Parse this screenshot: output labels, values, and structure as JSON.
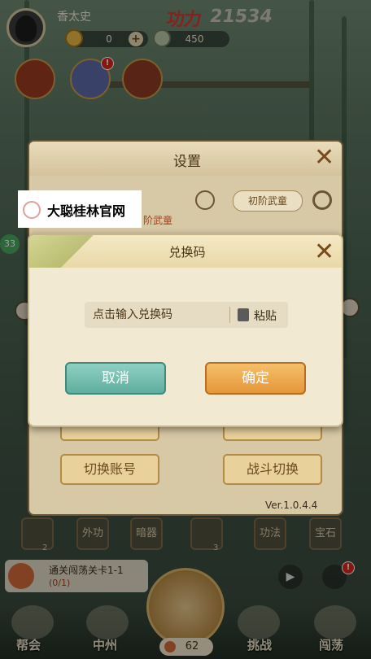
{
  "player": {
    "name": "香太史",
    "power_label": "功力",
    "power_value": "21534"
  },
  "resources": {
    "gold": "0",
    "jade": "450"
  },
  "features": [
    {
      "icon": "lantern-icon"
    },
    {
      "icon": "mascot-icon",
      "badge": "!"
    },
    {
      "icon": "hero-icon"
    }
  ],
  "settings": {
    "title": "设置",
    "rank_chip": "初阶武童",
    "rank_text": "阶武童",
    "buttons": {
      "switch_account": "切换账号",
      "battle_switch": "战斗切换"
    },
    "version": "Ver.1.0.4.4"
  },
  "redeem": {
    "title": "兑换码",
    "placeholder": "点击输入兑换码",
    "paste": "粘贴",
    "cancel": "取消",
    "confirm": "确定"
  },
  "watermark": {
    "text": "大聪桂林官网"
  },
  "side": {
    "level_badge": "33"
  },
  "equipment": [
    {
      "label": "",
      "count": "2"
    },
    {
      "label": "外功",
      "count": ""
    },
    {
      "label": "暗器",
      "count": ""
    },
    {
      "label": "",
      "count": "3"
    },
    {
      "label": "功法",
      "count": ""
    },
    {
      "label": "宝石",
      "count": ""
    }
  ],
  "quest": {
    "title": "通关闯荡关卡1-1",
    "progress": "(0/1)"
  },
  "nav": {
    "guild": "帮会",
    "zhongzhou": "中州",
    "center_count": "62",
    "challenge": "挑战",
    "adventure": "闯荡"
  },
  "colors": {
    "cancel": "#5fae9f",
    "confirm": "#e6963a",
    "panel": "#f2e9d3",
    "power": "#d23a2e"
  }
}
